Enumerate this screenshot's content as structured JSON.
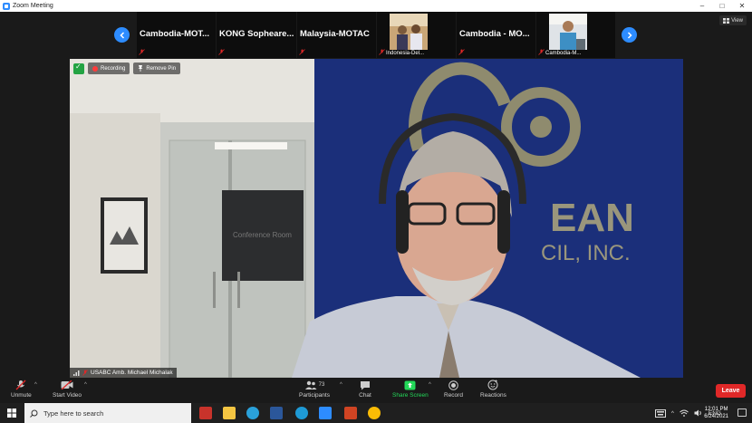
{
  "window": {
    "title": "Zoom Meeting",
    "controls": [
      "–",
      "□",
      "✕"
    ]
  },
  "gallery": {
    "view_label": "View",
    "participants": [
      {
        "name": "Cambodia-MOT...",
        "caption": "",
        "has_video": false
      },
      {
        "name": "KONG Sopheare...",
        "caption": "",
        "has_video": false
      },
      {
        "name": "Malaysia-MOTAC",
        "caption": "",
        "has_video": false
      },
      {
        "name": "",
        "caption": "Indonesia-Del...",
        "has_video": true
      },
      {
        "name": "Cambodia - MO...",
        "caption": "",
        "has_video": false
      },
      {
        "name": "",
        "caption": "Cambodia-M...",
        "has_video": true
      }
    ]
  },
  "main_video": {
    "recording_label": "Recording",
    "remove_pin_label": "Remove Pin",
    "speaker_name": "USABC Amb. Michael Michalak",
    "background_text": {
      "room_sign": "Conference Room",
      "logo_line1": "EAN",
      "logo_line2": "CIL, INC."
    }
  },
  "toolbar": {
    "unmute": "Unmute",
    "start_video": "Start Video",
    "participants": "Participants",
    "participant_count": "73",
    "chat": "Chat",
    "share_screen": "Share Screen",
    "record": "Record",
    "reactions": "Reactions",
    "leave": "Leave"
  },
  "taskbar": {
    "search_placeholder": "Type here to search",
    "language": "ENG",
    "time": "12:01 PM",
    "date": "6/24/2021"
  },
  "colors": {
    "accent": "#2d8cff",
    "leave": "#e02828",
    "share_green": "#23d959",
    "background": "#1a1a1a"
  }
}
